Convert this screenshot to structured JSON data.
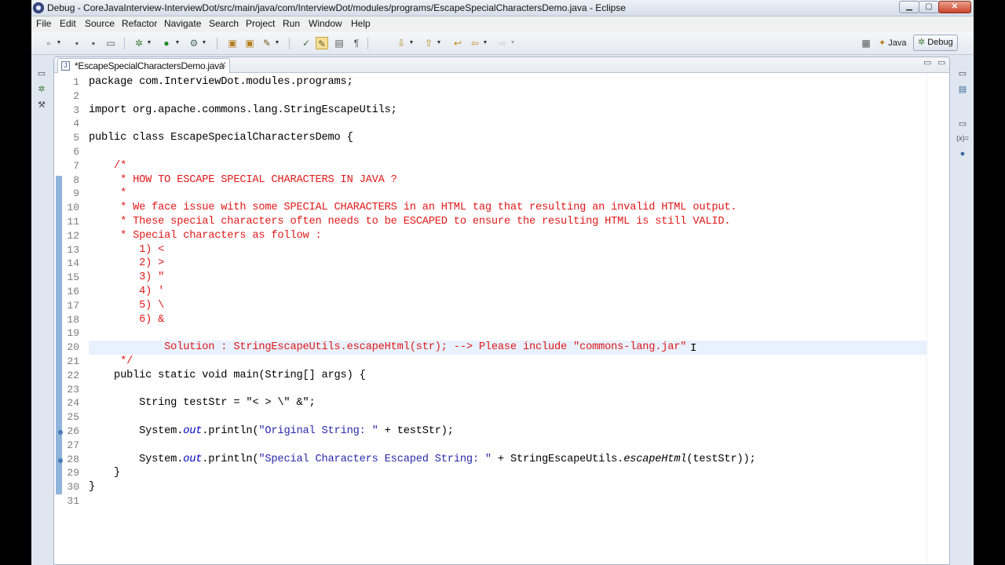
{
  "window": {
    "title": "Debug - CoreJavaInterview-InterviewDot/src/main/java/com/InterviewDot/modules/programs/EscapeSpecialCharactersDemo.java - Eclipse",
    "minimize": "▁",
    "maximize": "▢",
    "close": "✕"
  },
  "menu": [
    "File",
    "Edit",
    "Source",
    "Refactor",
    "Navigate",
    "Search",
    "Project",
    "Run",
    "Window",
    "Help"
  ],
  "perspectives": {
    "java": "Java",
    "debug": "Debug"
  },
  "editor": {
    "tab_label": "*EscapeSpecialCharactersDemo.java",
    "tab_close": "✕",
    "minimize": "▭",
    "maximize": "▭",
    "highlighted_line": 20,
    "lines": [
      {
        "n": "1",
        "segs": [
          {
            "t": "package com.InterviewDot.modules.programs;",
            "c": "kw"
          }
        ]
      },
      {
        "n": "2",
        "segs": []
      },
      {
        "n": "3",
        "segs": [
          {
            "t": "import org.apache.commons.lang.StringEscapeUtils;",
            "c": "kw"
          }
        ]
      },
      {
        "n": "4",
        "segs": []
      },
      {
        "n": "5",
        "segs": [
          {
            "t": "public class EscapeSpecialCharactersDemo {",
            "c": "kw"
          }
        ]
      },
      {
        "n": "6",
        "segs": []
      },
      {
        "n": "7",
        "segs": [
          {
            "t": "    /*",
            "c": "cm"
          }
        ]
      },
      {
        "n": "8",
        "segs": [
          {
            "t": "     * HOW TO ESCAPE SPECIAL CHARACTERS IN JAVA ?",
            "c": "cm"
          }
        ]
      },
      {
        "n": "9",
        "segs": [
          {
            "t": "     *",
            "c": "cm"
          }
        ]
      },
      {
        "n": "10",
        "segs": [
          {
            "t": "     * We face issue with some SPECIAL CHARACTERS in an HTML tag that resulting an invalid HTML output.",
            "c": "cm"
          }
        ]
      },
      {
        "n": "11",
        "segs": [
          {
            "t": "     * These special characters often needs to be ESCAPED to ensure the resulting HTML is still VALID.",
            "c": "cm"
          }
        ]
      },
      {
        "n": "12",
        "segs": [
          {
            "t": "     * Special characters as follow :",
            "c": "cm"
          }
        ]
      },
      {
        "n": "13",
        "segs": [
          {
            "t": "        1) <",
            "c": "cm"
          }
        ]
      },
      {
        "n": "14",
        "segs": [
          {
            "t": "        2) >",
            "c": "cm"
          }
        ]
      },
      {
        "n": "15",
        "segs": [
          {
            "t": "        3) \"",
            "c": "cm"
          }
        ]
      },
      {
        "n": "16",
        "segs": [
          {
            "t": "        4) '",
            "c": "cm"
          }
        ]
      },
      {
        "n": "17",
        "segs": [
          {
            "t": "        5) \\",
            "c": "cm"
          }
        ]
      },
      {
        "n": "18",
        "segs": [
          {
            "t": "        6) &",
            "c": "cm"
          }
        ]
      },
      {
        "n": "19",
        "segs": []
      },
      {
        "n": "20",
        "segs": [
          {
            "t": "            Solution : StringEscapeUtils.escapeHtml(str); --> Please include \"commons-lang.jar\"",
            "c": "cm"
          }
        ]
      },
      {
        "n": "21",
        "segs": [
          {
            "t": "     */",
            "c": "cm"
          }
        ]
      },
      {
        "n": "22",
        "segs": [
          {
            "t": "    public static void main(String[] args) {",
            "c": "kw"
          }
        ]
      },
      {
        "n": "23",
        "segs": []
      },
      {
        "n": "24",
        "segs": [
          {
            "t": "        String testStr = \"< > \\\" &\";",
            "c": "kw"
          }
        ]
      },
      {
        "n": "25",
        "segs": []
      },
      {
        "n": "26",
        "segs": [
          {
            "t": "        System.",
            "c": "kw"
          },
          {
            "t": "out",
            "c": "it"
          },
          {
            "t": ".println(",
            "c": "kw"
          },
          {
            "t": "\"Original String: \"",
            "c": "str"
          },
          {
            "t": " + testStr);",
            "c": "kw"
          }
        ]
      },
      {
        "n": "27",
        "segs": []
      },
      {
        "n": "28",
        "segs": [
          {
            "t": "        System.",
            "c": "kw"
          },
          {
            "t": "out",
            "c": "it"
          },
          {
            "t": ".println(",
            "c": "kw"
          },
          {
            "t": "\"Special Characters Escaped String: \"",
            "c": "str"
          },
          {
            "t": " + StringEscapeUtils.",
            "c": "kw"
          },
          {
            "t": "escapeHtml",
            "c": "it2"
          },
          {
            "t": "(testStr));",
            "c": "kw"
          }
        ]
      },
      {
        "n": "29",
        "segs": [
          {
            "t": "    }",
            "c": "kw"
          }
        ]
      },
      {
        "n": "30",
        "segs": [
          {
            "t": "}",
            "c": "kw"
          }
        ]
      },
      {
        "n": "31",
        "segs": []
      }
    ]
  },
  "colors": {
    "comment": "#e0191a",
    "string": "#2a2aaa",
    "highlight": "#e8f2fe",
    "fold_bar": "#8fb3d9"
  }
}
